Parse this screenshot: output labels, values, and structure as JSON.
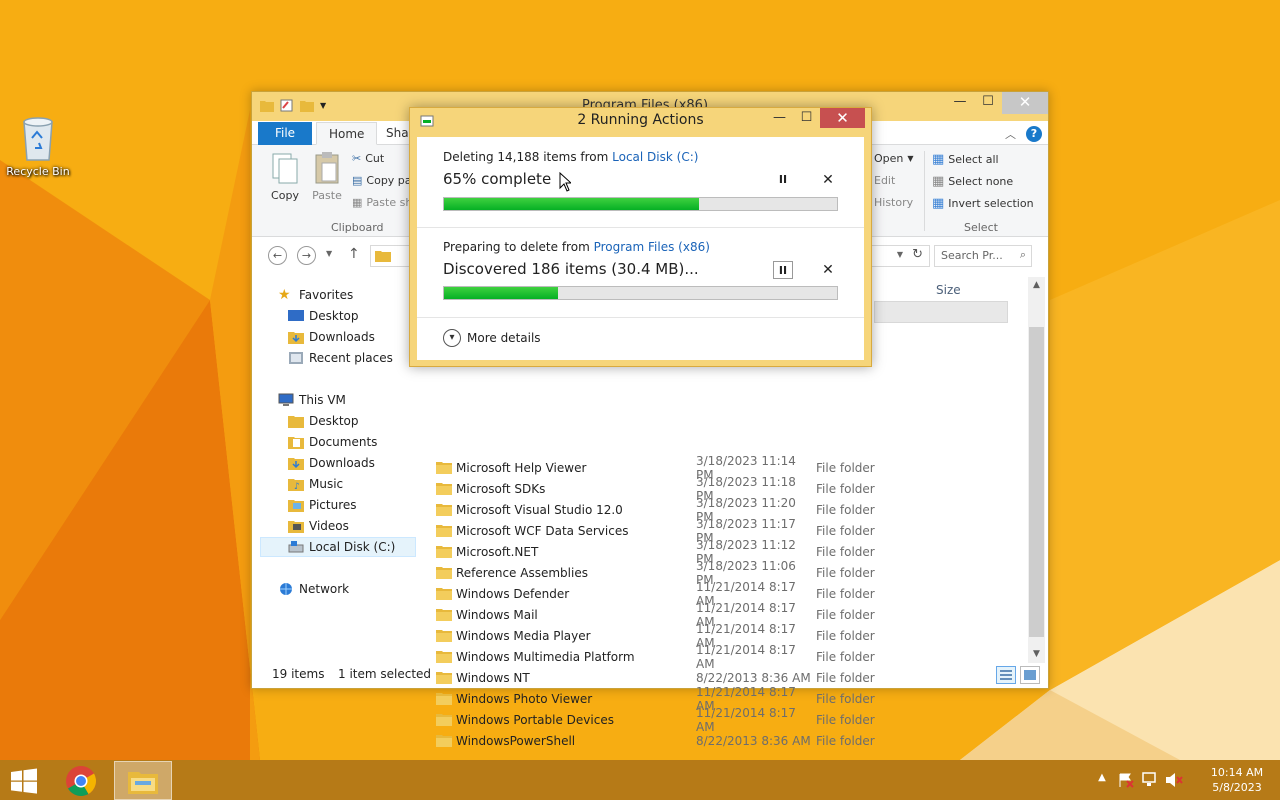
{
  "desktop": {
    "recycle_bin_label": "Recycle Bin"
  },
  "explorer": {
    "title": "Program Files (x86)",
    "controls": {
      "minimize": "—",
      "maximize": "☐",
      "close": "✕"
    },
    "ribbon_tabs": {
      "file": "File",
      "home": "Home",
      "share": "Shar"
    },
    "ribbon": {
      "copy": "Copy",
      "paste": "Paste",
      "cut": "Cut",
      "copy_path": "Copy pa",
      "paste_shortcut": "Paste sh",
      "clipboard_group": "Clipboard",
      "open": "Open",
      "edit": "Edit",
      "history": "History",
      "select_all": "Select all",
      "select_none": "Select none",
      "invert_selection": "Invert selection",
      "select_group": "Select"
    },
    "search_placeholder": "Search Pr...",
    "nav": {
      "favorites": "Favorites",
      "desktop": "Desktop",
      "downloads": "Downloads",
      "recent_places": "Recent places",
      "this_vm": "This VM",
      "vm_desktop": "Desktop",
      "documents": "Documents",
      "vm_downloads": "Downloads",
      "music": "Music",
      "pictures": "Pictures",
      "videos": "Videos",
      "local_disk": "Local Disk (C:)",
      "network": "Network"
    },
    "columns": {
      "size": "Size"
    },
    "files": [
      {
        "name": "Microsoft Help Viewer",
        "date": "3/18/2023 11:14 PM",
        "type": "File folder"
      },
      {
        "name": "Microsoft SDKs",
        "date": "3/18/2023 11:18 PM",
        "type": "File folder"
      },
      {
        "name": "Microsoft Visual Studio 12.0",
        "date": "3/18/2023 11:20 PM",
        "type": "File folder"
      },
      {
        "name": "Microsoft WCF Data Services",
        "date": "3/18/2023 11:17 PM",
        "type": "File folder"
      },
      {
        "name": "Microsoft.NET",
        "date": "3/18/2023 11:12 PM",
        "type": "File folder"
      },
      {
        "name": "Reference Assemblies",
        "date": "3/18/2023 11:06 PM",
        "type": "File folder"
      },
      {
        "name": "Windows Defender",
        "date": "11/21/2014 8:17 AM",
        "type": "File folder"
      },
      {
        "name": "Windows Mail",
        "date": "11/21/2014 8:17 AM",
        "type": "File folder"
      },
      {
        "name": "Windows Media Player",
        "date": "11/21/2014 8:17 AM",
        "type": "File folder"
      },
      {
        "name": "Windows Multimedia Platform",
        "date": "11/21/2014 8:17 AM",
        "type": "File folder"
      },
      {
        "name": "Windows NT",
        "date": "8/22/2013 8:36 AM",
        "type": "File folder"
      },
      {
        "name": "Windows Photo Viewer",
        "date": "11/21/2014 8:17 AM",
        "type": "File folder"
      },
      {
        "name": "Windows Portable Devices",
        "date": "11/21/2014 8:17 AM",
        "type": "File folder"
      },
      {
        "name": "WindowsPowerShell",
        "date": "8/22/2013 8:36 AM",
        "type": "File folder"
      }
    ],
    "status": {
      "count": "19 items",
      "selected": "1 item selected"
    }
  },
  "dialog": {
    "title": "2 Running Actions",
    "controls": {
      "minimize": "—",
      "maximize": "☐",
      "close": "✕"
    },
    "op1": {
      "prefix": "Deleting 14,188 items from ",
      "link": "Local Disk (C:)",
      "status": "65% complete",
      "progress": 0.65
    },
    "op2": {
      "prefix": "Preparing to delete from ",
      "link": "Program Files (x86)",
      "status": "Discovered 186 items (30.4 MB)...",
      "progress": 0.29
    },
    "pause_glyph": "II",
    "cancel_glyph": "✕",
    "more_details": "More details"
  },
  "taskbar": {
    "time": "10:14 AM",
    "date": "5/8/2023"
  },
  "colors": {
    "progress_green": "#06b025",
    "link_blue": "#1a63b8",
    "title_yellow": "#f6d57a",
    "file_tab_blue": "#1979ca",
    "close_red": "#c75050"
  }
}
